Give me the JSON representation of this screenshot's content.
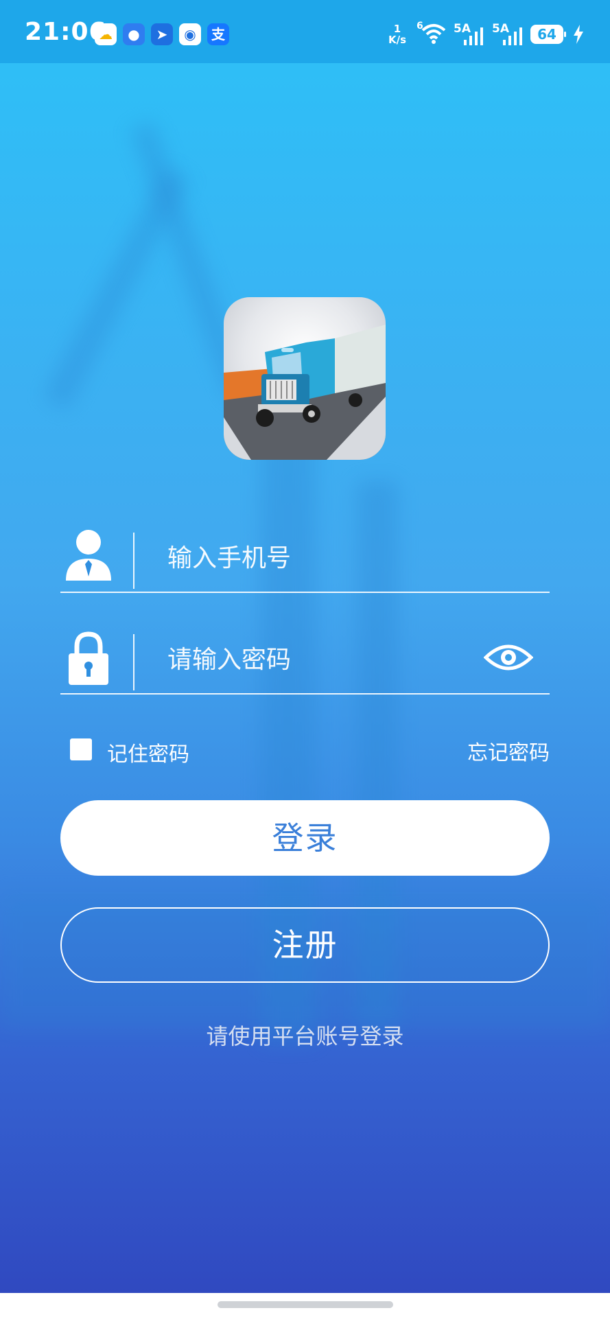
{
  "status_bar": {
    "time": "21:06",
    "net_speed_value": "1",
    "net_speed_unit": "K/s",
    "wifi_badge": "6",
    "signal1_label": "5A",
    "signal2_label": "5A",
    "battery": "64",
    "app_icons": [
      "cloud-icon",
      "message-icon",
      "feather-icon",
      "browser-icon",
      "alipay-icon"
    ],
    "alipay_glyph": "支"
  },
  "login": {
    "phone_placeholder": "输入手机号",
    "password_placeholder": "请输入密码",
    "remember_label": "记住密码",
    "forgot_label": "忘记密码",
    "login_button": "登录",
    "register_button": "注册",
    "hint": "请使用平台账号登录"
  },
  "colors": {
    "status_bar": "#1ea7ea",
    "login_text": "#3a7fd9",
    "bg_top": "#2cc1f7",
    "bg_bottom": "#3049c0"
  }
}
